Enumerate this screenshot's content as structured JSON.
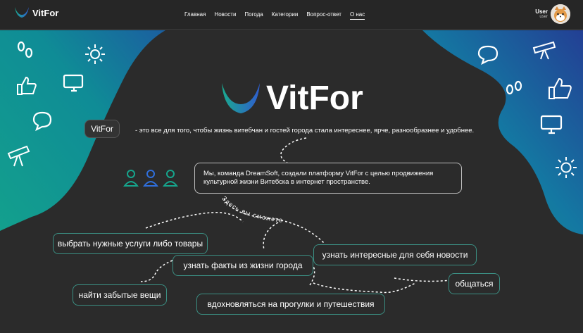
{
  "header": {
    "logo_text": "VitFor",
    "nav": [
      "Главная",
      "Новости",
      "Погода",
      "Категории",
      "Вопрос-ответ",
      "О нас"
    ],
    "active_nav": "О нас",
    "user_name": "User",
    "user_role": "user"
  },
  "hero": {
    "title": "VitFor",
    "badge": "VitFor",
    "tagline": "- это все для того, чтобы жизнь витебчан и гостей города стала интереснее, ярче, разнообразнее и удобнее.",
    "description": "Мы, команда DreamSoft, создали платформу VitFor с целью продвижения культурной жизни Витебска в интернет пространстве.",
    "curve_label": "Здесь вы сможете"
  },
  "features": [
    "выбрать нужные услуги либо товары",
    "узнать факты из жизни города",
    "узнать интересные для себя новости",
    "найти забытые вещи",
    "общаться",
    "вдохновляться на прогулки и путешествия"
  ],
  "colors": {
    "teal": "#16a58d",
    "blue": "#1d3f8c",
    "accent": "#2f8bdc"
  },
  "icons": [
    "footprints-icon",
    "sun-icon",
    "thumbs-up-icon",
    "monitor-icon",
    "chat-bubble-icon",
    "telescope-icon",
    "people-icon"
  ]
}
